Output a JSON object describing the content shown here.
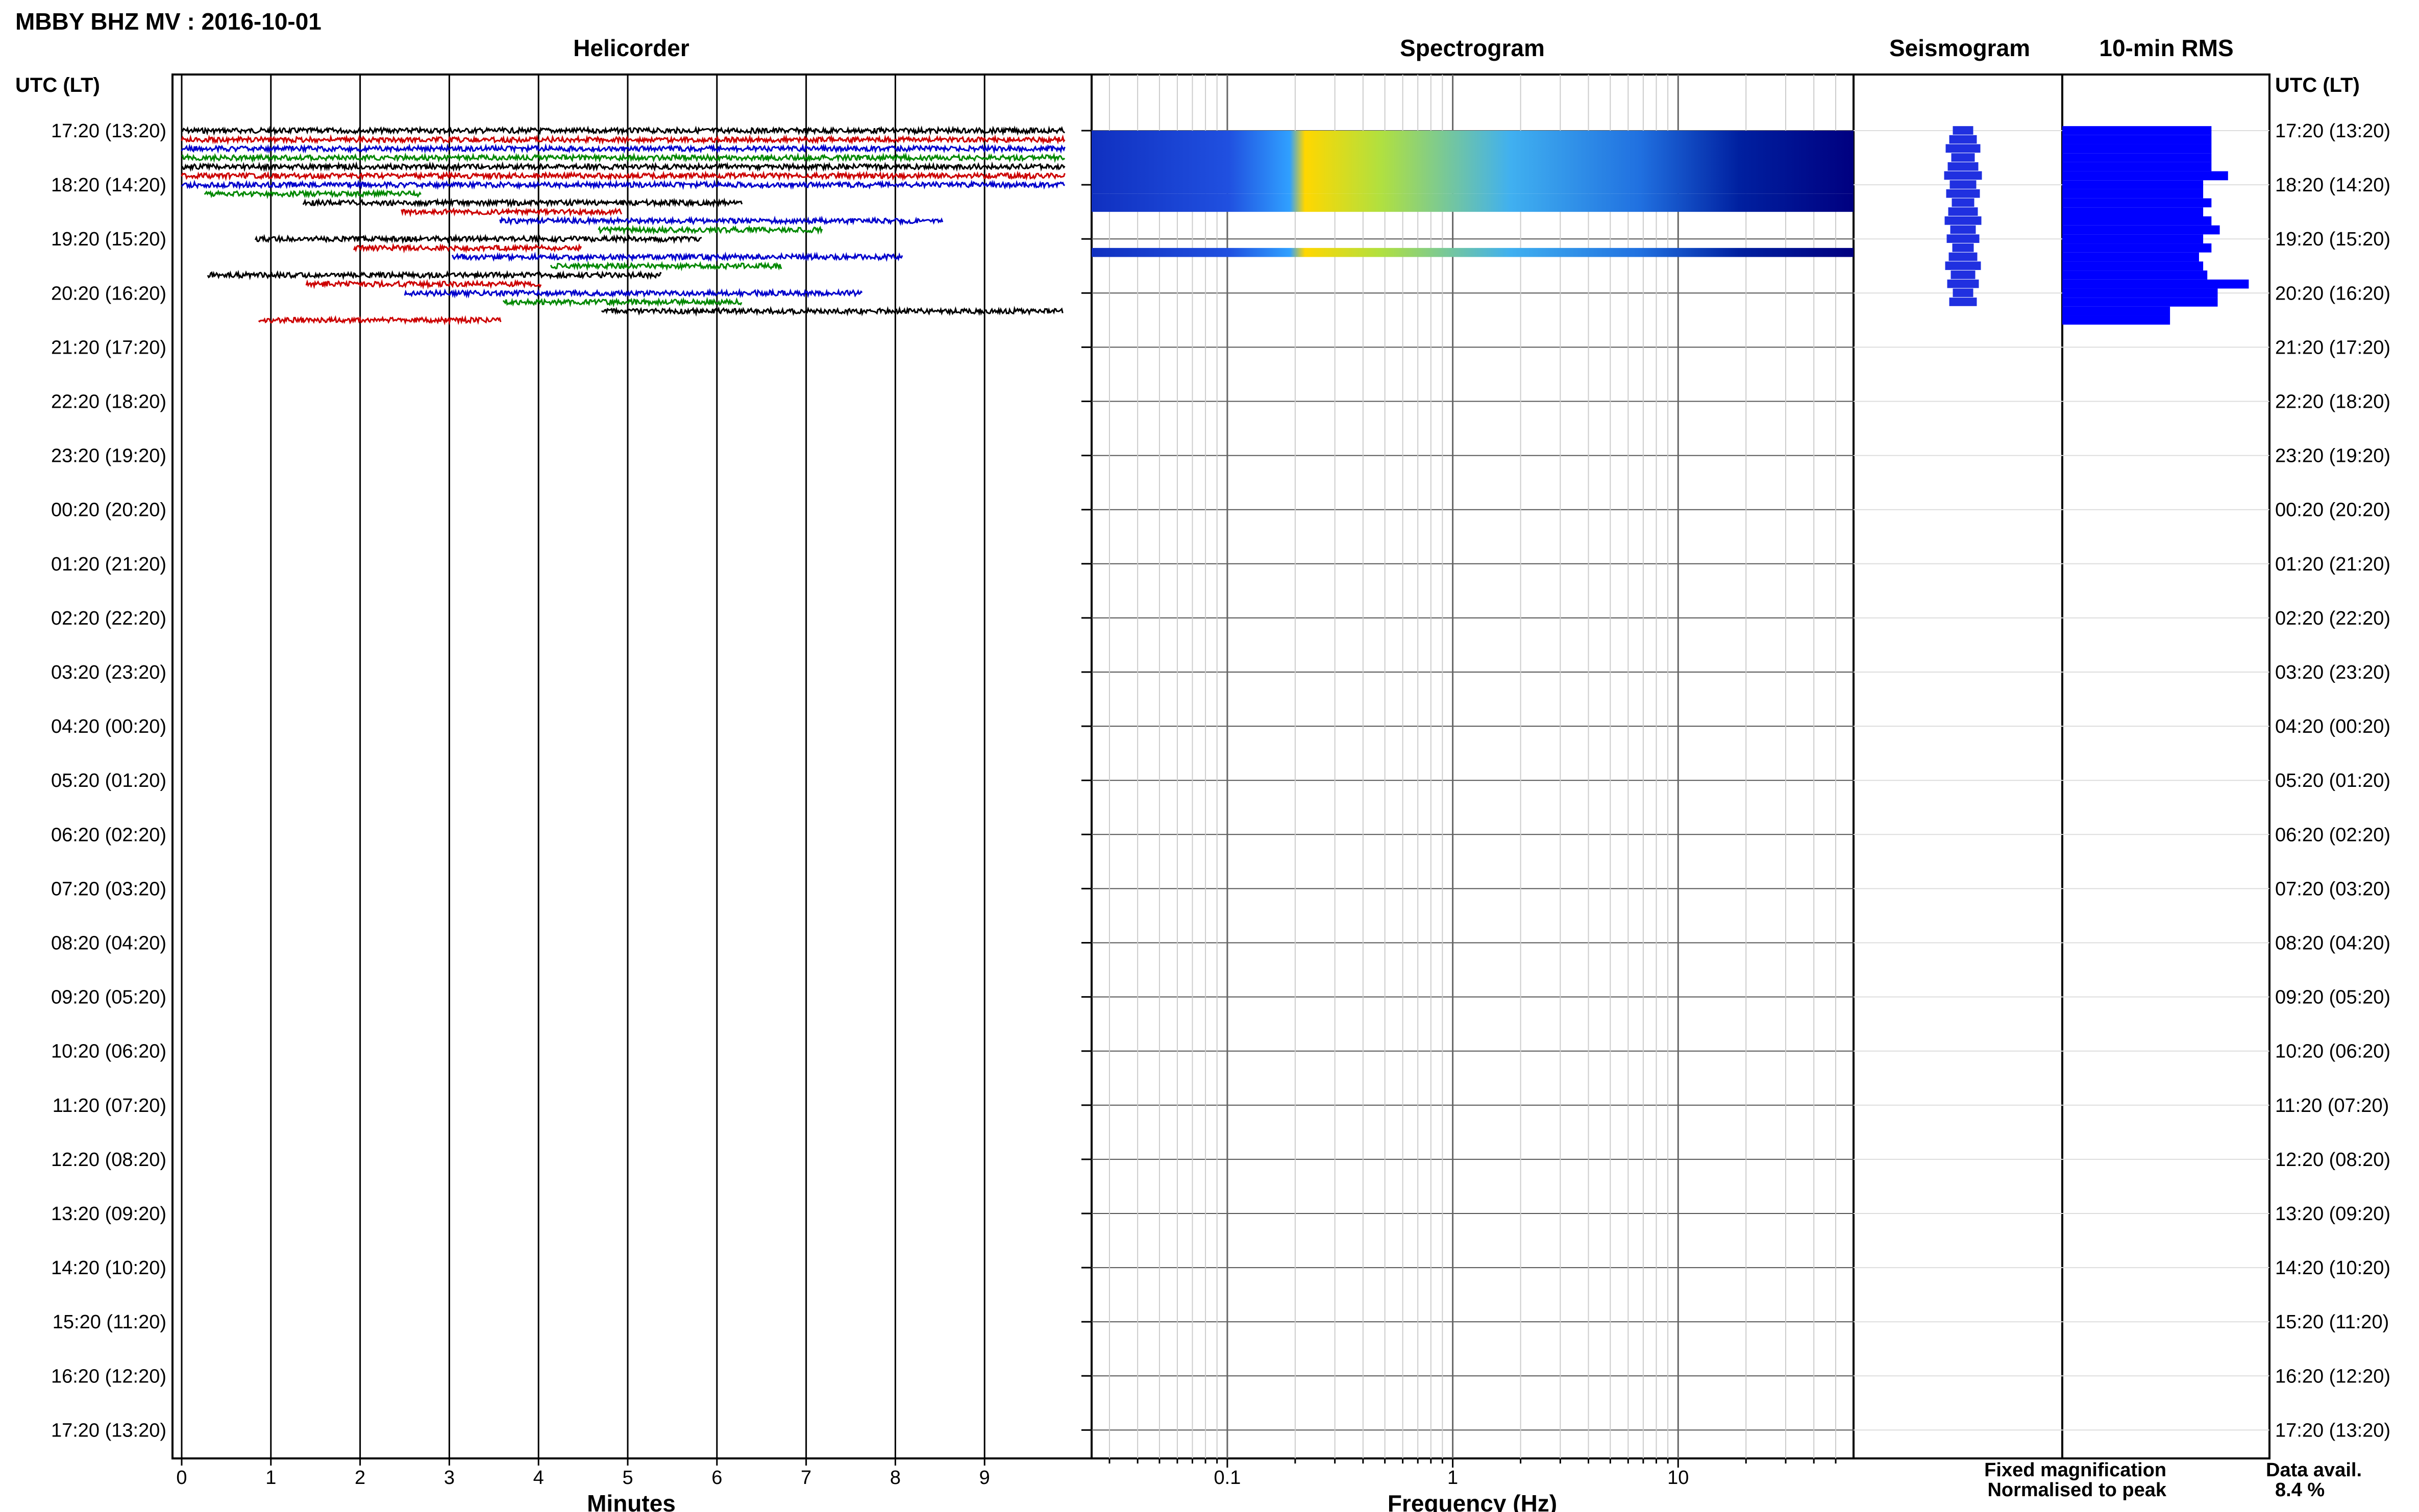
{
  "title": "MBBY BHZ MV : 2016-10-01",
  "panels": {
    "helicorder": "Helicorder",
    "spectrogram": "Spectrogram",
    "seismogram": "Seismogram",
    "rms": "10-min RMS"
  },
  "axis_labels": {
    "left_header": "UTC (LT)",
    "right_header": "UTC (LT)",
    "minutes": "Minutes",
    "frequency": "Frequency (Hz)"
  },
  "time_labels": [
    "17:20 (13:20)",
    "18:20 (14:20)",
    "19:20 (15:20)",
    "20:20 (16:20)",
    "21:20 (17:20)",
    "22:20 (18:20)",
    "23:20 (19:20)",
    "00:20 (20:20)",
    "01:20 (21:20)",
    "02:20 (22:20)",
    "03:20 (23:20)",
    "04:20 (00:20)",
    "05:20 (01:20)",
    "06:20 (02:20)",
    "07:20 (03:20)",
    "08:20 (04:20)",
    "09:20 (05:20)",
    "10:20 (06:20)",
    "11:20 (07:20)",
    "12:20 (08:20)",
    "13:20 (09:20)",
    "14:20 (10:20)",
    "15:20 (11:20)",
    "16:20 (12:20)",
    "17:20 (13:20)"
  ],
  "minute_ticks": [
    "0",
    "1",
    "2",
    "3",
    "4",
    "5",
    "6",
    "7",
    "8",
    "9"
  ],
  "freq_ticks": [
    "0.1",
    "1",
    "10"
  ],
  "legend": {
    "fixed": "Fixed magnification",
    "normalised": "Normalised to peak",
    "fixed_color": "#0000ff",
    "normalised_color": "#ff0000"
  },
  "data_avail": {
    "label": "Data avail.",
    "value": "8.4 %"
  },
  "colors": {
    "trace": [
      "#000000",
      "#cc0000",
      "#0000cc",
      "#008800"
    ],
    "spectrogram_low": "#000080",
    "spectrogram_high": "#ffd700",
    "rms_bar": "#0000ff"
  },
  "chart_data": [
    {
      "type": "line",
      "title": "Helicorder",
      "xlabel": "Minutes",
      "xlim": [
        0,
        10
      ],
      "row_interval_minutes": 10,
      "rows_with_data": [
        0,
        1,
        2,
        3,
        4,
        5,
        6,
        7,
        8,
        9,
        10,
        11,
        12,
        13,
        14,
        15,
        16,
        17,
        18,
        19,
        20,
        21
      ],
      "rows_total": 145
    },
    {
      "type": "heatmap",
      "title": "Spectrogram",
      "xlabel": "Frequency (Hz)",
      "xscale": "log",
      "xlim": [
        0.025,
        60
      ],
      "bands": [
        {
          "row_start": 0,
          "row_end": 6,
          "peak_freq_range": [
            0.2,
            5
          ]
        },
        {
          "row_start": 7,
          "row_end": 8,
          "peak_freq_range": [
            0.2,
            5
          ]
        },
        {
          "row_start": 13,
          "row_end": 13,
          "peak_freq_range": [
            0.2,
            2
          ]
        }
      ]
    },
    {
      "type": "bar",
      "title": "10-min RMS",
      "orientation": "horizontal",
      "values": [
        0.72,
        0.72,
        0.72,
        0.72,
        0.72,
        0.8,
        0.68,
        0.68,
        0.72,
        0.68,
        0.72,
        0.76,
        0.68,
        0.72,
        0.66,
        0.68,
        0.7,
        0.9,
        0.75,
        0.75,
        0.52,
        0.52
      ],
      "row_index": [
        0,
        1,
        2,
        3,
        4,
        5,
        6,
        7,
        8,
        9,
        10,
        11,
        12,
        13,
        14,
        15,
        16,
        17,
        18,
        19,
        20,
        21
      ]
    }
  ]
}
